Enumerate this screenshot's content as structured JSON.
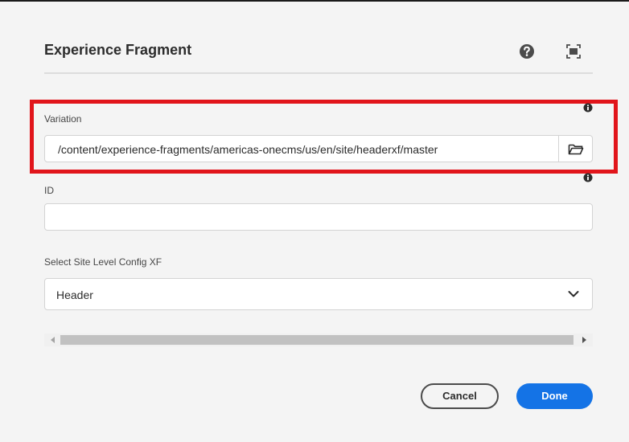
{
  "dialog": {
    "title": "Experience Fragment",
    "icons": {
      "help": "help-circle-icon",
      "fullscreen": "fullscreen-icon"
    }
  },
  "fields": {
    "variation": {
      "label": "Variation",
      "value": "/content/experience-fragments/americas-onecms/us/en/site/headerxf/master",
      "browse_icon": "folder-icon",
      "info_icon": "info-icon"
    },
    "id": {
      "label": "ID",
      "value": "",
      "info_icon": "info-icon"
    },
    "site_config": {
      "label": "Select Site Level Config XF",
      "selected": "Header",
      "icon": "chevron-down-icon"
    }
  },
  "buttons": {
    "cancel": "Cancel",
    "done": "Done"
  },
  "colors": {
    "accent": "#1473e6",
    "highlight": "#e1151b",
    "background": "#f4f4f4"
  }
}
